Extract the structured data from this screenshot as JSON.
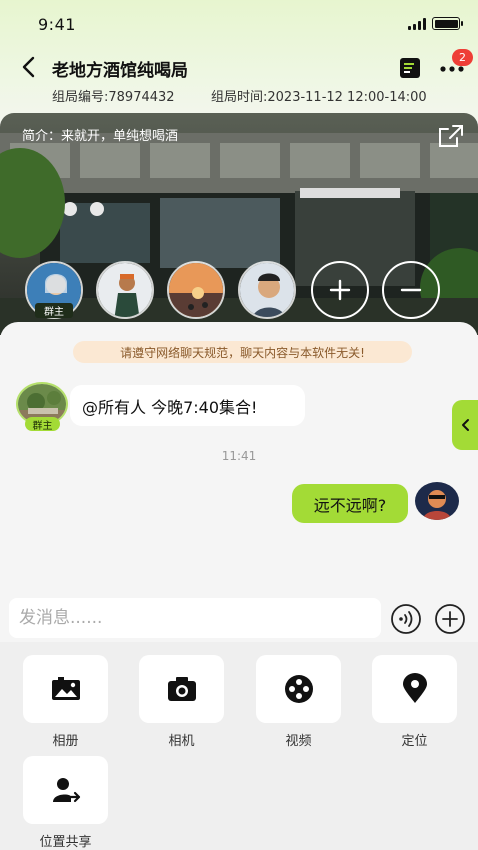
{
  "status_bar": {
    "time": "9:41"
  },
  "header": {
    "title": "老地方酒馆纯喝局",
    "badge_count": "2",
    "group_id": "组局编号:78974432",
    "group_time": "组局时间:2023-11-12 12:00-14:00"
  },
  "banner": {
    "intro": "简介：来就开，单纯想喝酒",
    "host_tag": "群主",
    "members": [
      "member-1",
      "member-2",
      "member-3",
      "member-4"
    ],
    "add_icon": "plus-icon",
    "remove_icon": "minus-icon"
  },
  "chat": {
    "notice": "请遵守网络聊天规范，聊天内容与本软件无关!",
    "host_tag": "群主",
    "messages": [
      {
        "side": "left",
        "text": "@所有人 今晚7:40集合!"
      },
      {
        "side": "right",
        "text": "远不远啊?"
      }
    ],
    "time_divider": "11:41"
  },
  "input": {
    "placeholder": "发消息......"
  },
  "actions": [
    {
      "label": "相册",
      "icon": "album-icon"
    },
    {
      "label": "相机",
      "icon": "camera-icon"
    },
    {
      "label": "视频",
      "icon": "video-icon"
    },
    {
      "label": "定位",
      "icon": "location-icon"
    },
    {
      "label": "位置共享",
      "icon": "location-share-icon"
    }
  ],
  "colors": {
    "accent": "#a3db36",
    "badge": "#ee3e36",
    "notice_bg": "#fbe8d3"
  }
}
